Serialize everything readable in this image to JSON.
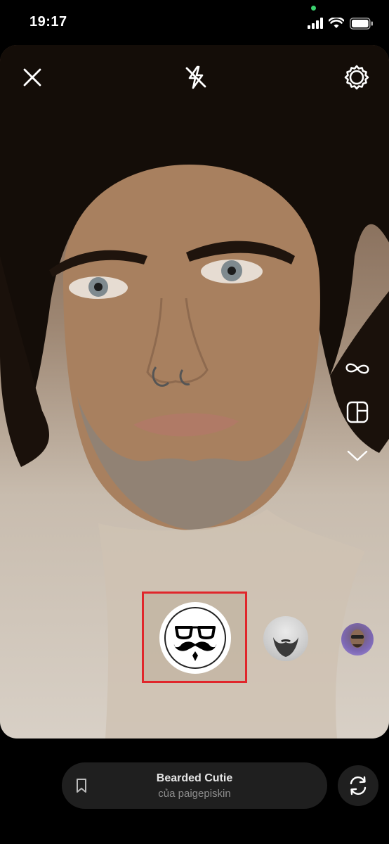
{
  "status_bar": {
    "time": "19:17",
    "icons": [
      "signal-icon",
      "wifi-icon",
      "battery-icon"
    ]
  },
  "camera": {
    "top_controls": [
      "close-icon",
      "flash-off-icon",
      "settings-icon"
    ],
    "side_tools": [
      "infinity-icon",
      "layout-icon",
      "chevron-down-icon"
    ]
  },
  "effects": {
    "items": [
      "mustache-glasses-effect",
      "beard-effect",
      "avatar-effect"
    ],
    "selected": "mustache-glasses-effect",
    "highlight_color": "#e0262b"
  },
  "effect_info": {
    "name": "Bearded Cutie",
    "author": "của paigepiskin"
  },
  "colors": {
    "background": "#000000",
    "pill": "#1f1f1f",
    "status_dot": "#3bd16f"
  }
}
